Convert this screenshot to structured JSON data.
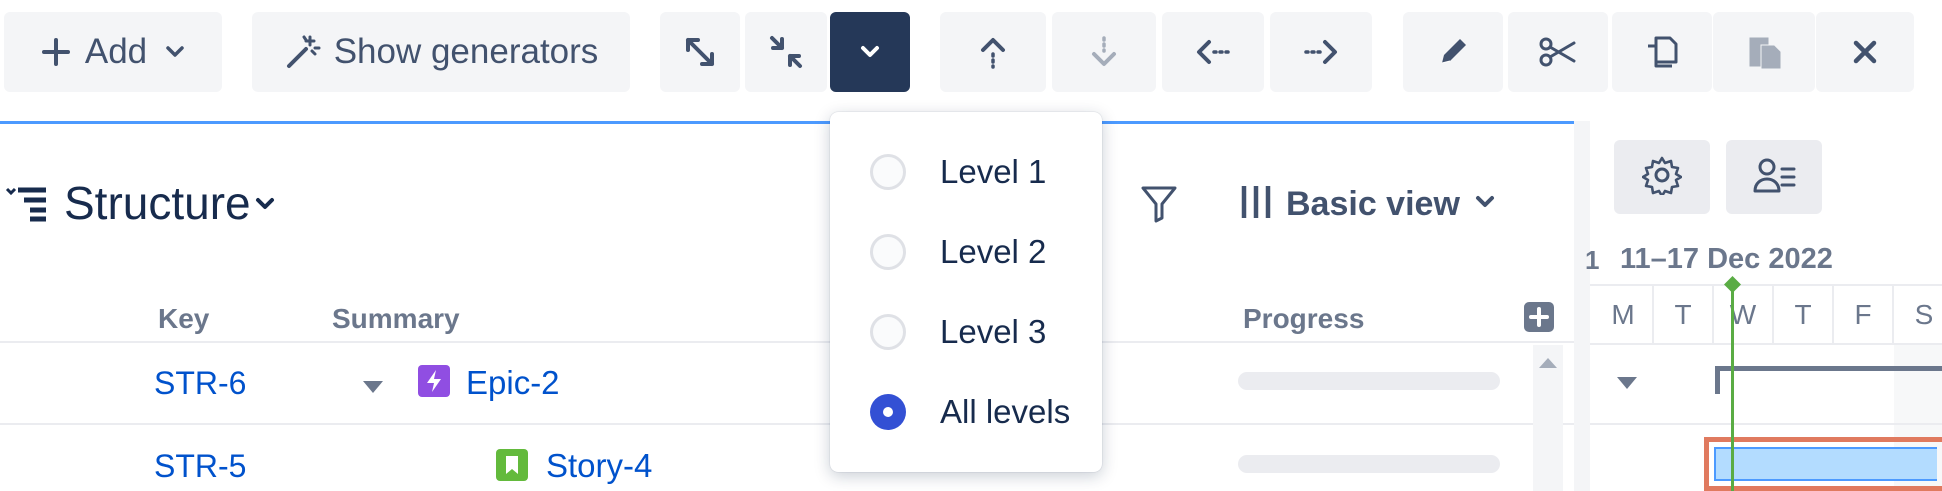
{
  "toolbar": {
    "add_label": "Add",
    "show_generators_label": "Show generators"
  },
  "structure": {
    "title": "Structure",
    "view_label": "Basic view",
    "columns": {
      "key": "Key",
      "summary": "Summary",
      "progress": "Progress"
    },
    "rows": [
      {
        "key": "STR-6",
        "summary": "Epic-2",
        "type": "epic",
        "icon_color": "#904ee2"
      },
      {
        "key": "STR-5",
        "summary": "Story-4",
        "type": "story",
        "icon_color": "#63ba3c"
      }
    ]
  },
  "gantt": {
    "week_label": "11–17 Dec 2022",
    "week_prefix": "1",
    "days": [
      "M",
      "T",
      "W",
      "T",
      "F",
      "S"
    ]
  },
  "expand_menu": {
    "options": [
      {
        "label": "Level 1",
        "checked": false
      },
      {
        "label": "Level 2",
        "checked": false
      },
      {
        "label": "Level 3",
        "checked": false
      },
      {
        "label": "All levels",
        "checked": true
      }
    ]
  },
  "colors": {
    "accent": "#0052cc",
    "active_button": "#253858",
    "radio_checked": "#3350d4",
    "today_line": "#5aac44",
    "selected_bar_border": "#e07a5f",
    "bar_fill": "#b3dcff"
  }
}
